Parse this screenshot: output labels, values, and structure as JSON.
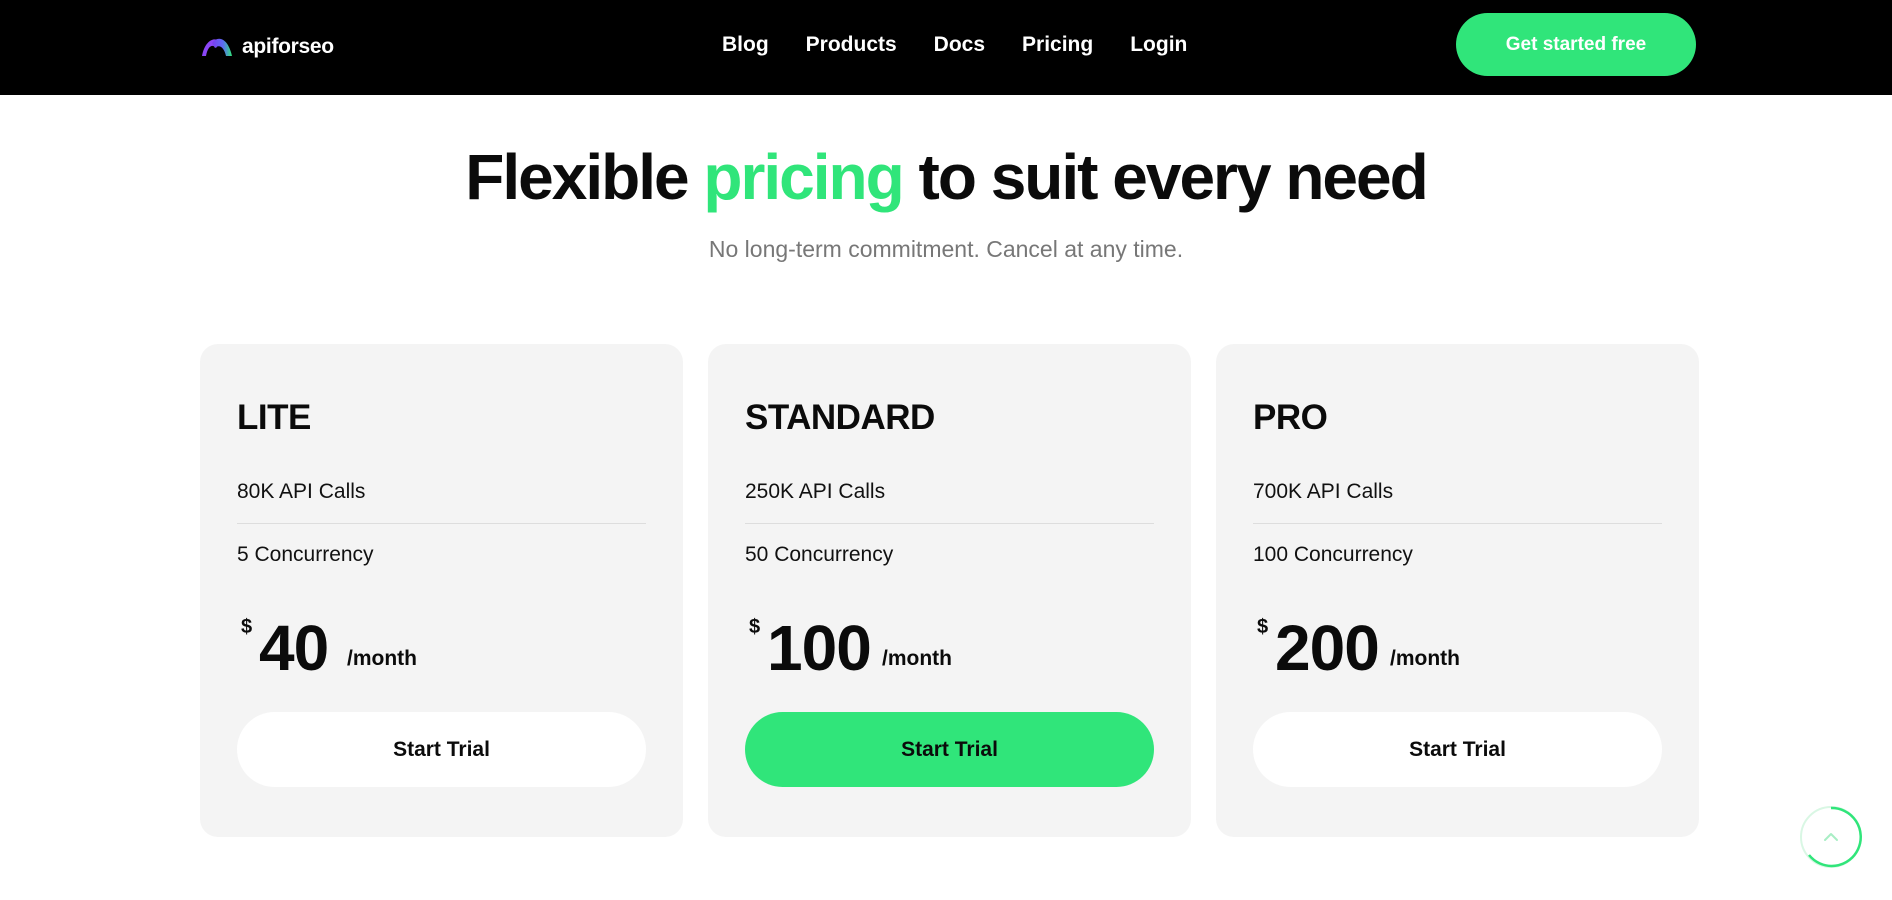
{
  "header": {
    "logo_text": "apiforseo",
    "nav": [
      "Blog",
      "Products",
      "Docs",
      "Pricing",
      "Login"
    ],
    "cta_label": "Get started free"
  },
  "hero": {
    "title_before": "Flexible ",
    "title_accent": "pricing",
    "title_after": " to suit every need",
    "subtitle": "No long-term commitment. Cancel at any time."
  },
  "plans": [
    {
      "name": "LITE",
      "api_calls": "80K API Calls",
      "concurrency": "5 Concurrency",
      "currency": "$",
      "price": "40",
      "period": "/month",
      "button": "Start Trial"
    },
    {
      "name": "STANDARD",
      "api_calls": "250K API Calls",
      "concurrency": "50 Concurrency",
      "currency": "$",
      "price": "100",
      "period": "/month",
      "button": "Start Trial"
    },
    {
      "name": "PRO",
      "api_calls": "700K API Calls",
      "concurrency": "100 Concurrency",
      "currency": "$",
      "price": "200",
      "period": "/month",
      "button": "Start Trial"
    }
  ],
  "colors": {
    "accent": "#30e57a",
    "header_bg": "#000000",
    "card_bg": "#f4f4f4",
    "subtitle": "#777777"
  },
  "icons": {
    "logo": "arc-logo-icon",
    "back_to_top": "chevron-up-icon"
  }
}
